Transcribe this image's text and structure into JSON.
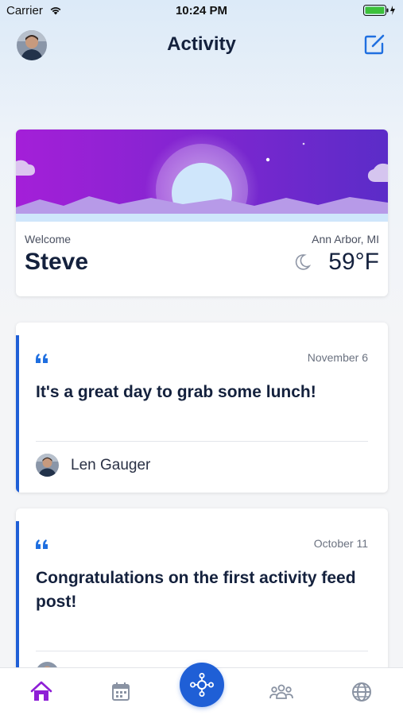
{
  "status_bar": {
    "carrier": "Carrier",
    "time": "10:24 PM",
    "wifi_icon": "wifi-icon",
    "battery_icon": "battery-charging-icon"
  },
  "header": {
    "title": "Activity",
    "avatar_icon": "user-avatar",
    "compose_icon": "compose-icon"
  },
  "welcome": {
    "label": "Welcome",
    "name": "Steve",
    "location": "Ann Arbor, MI",
    "temperature": "59°F",
    "weather_icon": "moon-icon"
  },
  "posts": [
    {
      "date": "November 6",
      "text": "It's a great day to grab some lunch!",
      "author": "Len Gauger"
    },
    {
      "date": "October 11",
      "text": "Congratulations on the first activity feed post!",
      "author": ""
    }
  ],
  "tabs": [
    {
      "icon": "home-icon",
      "active": true
    },
    {
      "icon": "calendar-icon",
      "active": false
    },
    {
      "icon": "hub-icon",
      "active": false
    },
    {
      "icon": "people-icon",
      "active": false
    },
    {
      "icon": "globe-icon",
      "active": false
    }
  ],
  "colors": {
    "accent": "#1f5fd6",
    "active_tab": "#8e1fd6",
    "banner_start": "#a41fd8",
    "banner_end": "#5b2cc8"
  }
}
